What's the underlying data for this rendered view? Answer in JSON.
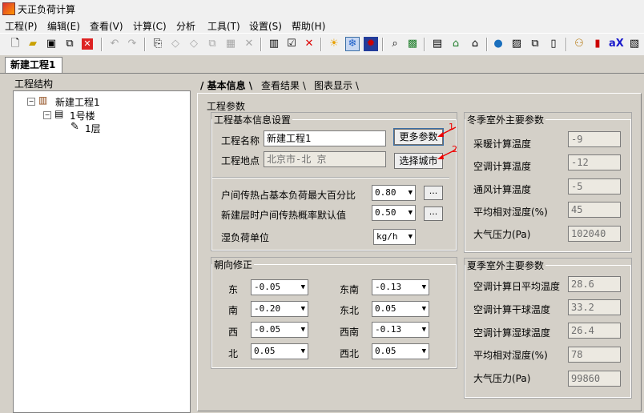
{
  "window": {
    "title": "天正负荷计算"
  },
  "menu": [
    "工程(P)",
    "编辑(E)",
    "查看(V)",
    "计算(C)",
    "分析",
    "工具(T)",
    "设置(S)",
    "帮助(H)"
  ],
  "doc_tab": "新建工程1",
  "tree": {
    "label": "工程结构",
    "project": "新建工程1",
    "building": "1号楼",
    "floor": "1层"
  },
  "tabs": [
    "基本信息",
    "查看结果",
    "图表显示"
  ],
  "params_title": "工程参数",
  "basic": {
    "title": "工程基本信息设置",
    "name_label": "工程名称",
    "name_value": "新建工程1",
    "more_button": "更多参数",
    "location_label": "工程地点",
    "location_value": "北京市-北  京",
    "city_button": "选择城市",
    "pct_label": "户间传热占基本负荷最大百分比",
    "pct_value": "0.80",
    "prob_label": "新建层时户间传热概率默认值",
    "prob_value": "0.50",
    "humid_label": "湿负荷单位",
    "humid_value": "kg/h",
    "dots": "..."
  },
  "annotations": {
    "one": "1",
    "two": "2"
  },
  "orientation": {
    "title": "朝向修正",
    "items": [
      {
        "label": "东",
        "value": "-0.05"
      },
      {
        "label": "南",
        "value": "-0.20"
      },
      {
        "label": "西",
        "value": "-0.05"
      },
      {
        "label": "北",
        "value": "0.05"
      },
      {
        "label": "东南",
        "value": "-0.13"
      },
      {
        "label": "东北",
        "value": "0.05"
      },
      {
        "label": "西南",
        "value": "-0.13"
      },
      {
        "label": "西北",
        "value": "0.05"
      }
    ]
  },
  "winter": {
    "title": "冬季室外主要参数",
    "rows": [
      {
        "label": "采暖计算温度",
        "value": "-9"
      },
      {
        "label": "空调计算温度",
        "value": "-12"
      },
      {
        "label": "通风计算温度",
        "value": "-5"
      },
      {
        "label": "平均相对湿度(%)",
        "value": "45"
      },
      {
        "label": "大气压力(Pa)",
        "value": "102040"
      }
    ]
  },
  "summer": {
    "title": "夏季室外主要参数",
    "rows": [
      {
        "label": "空调计算日平均温度",
        "value": "28.6"
      },
      {
        "label": "空调计算干球温度",
        "value": "33.2"
      },
      {
        "label": "空调计算湿球温度",
        "value": "26.4"
      },
      {
        "label": "平均相对湿度(%)",
        "value": "78"
      },
      {
        "label": "大气压力(Pa)",
        "value": "99860"
      }
    ]
  }
}
